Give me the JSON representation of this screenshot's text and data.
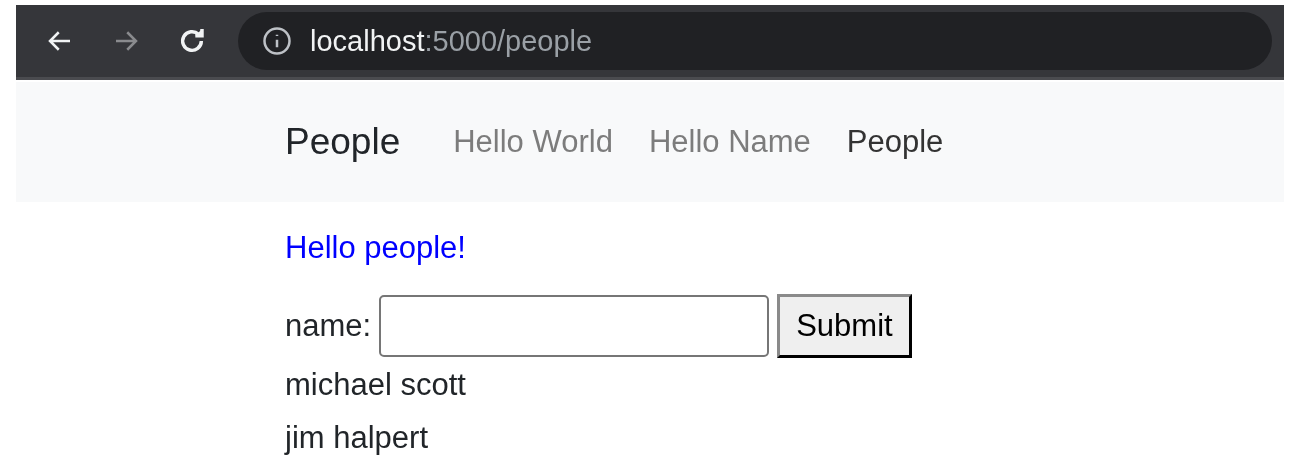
{
  "browser": {
    "url_host": "localhost",
    "url_rest": ":5000/people",
    "back_disabled": false,
    "forward_disabled": true
  },
  "navbar": {
    "brand": "People",
    "links": [
      {
        "label": "Hello World",
        "selected": false
      },
      {
        "label": "Hello Name",
        "selected": false
      },
      {
        "label": "People",
        "selected": true
      }
    ]
  },
  "greeting": "Hello people!",
  "form": {
    "label": "name:",
    "button": "Submit"
  },
  "people": [
    "michael scott",
    "jim halpert"
  ]
}
